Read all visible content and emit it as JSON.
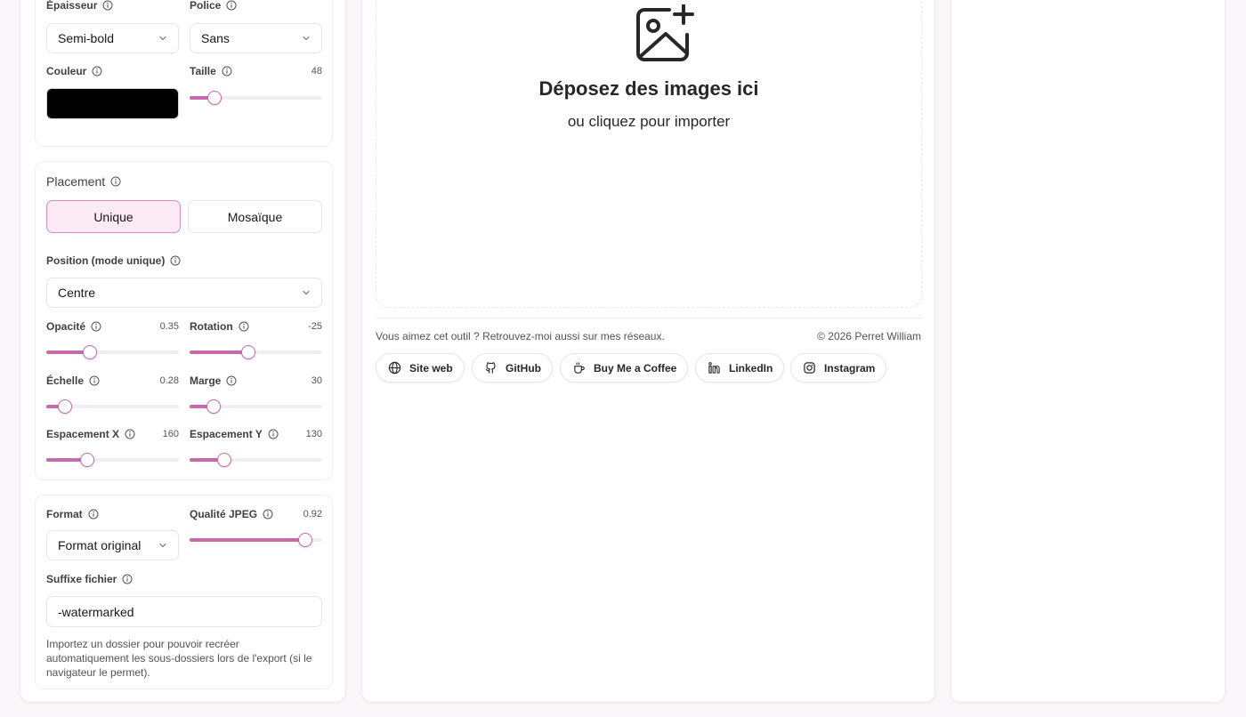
{
  "typography": {
    "weight": {
      "label": "Épaisseur",
      "value": "Semi-bold"
    },
    "font": {
      "label": "Police",
      "value": "Sans"
    },
    "color": {
      "label": "Couleur",
      "value": "#000000"
    },
    "size": {
      "label": "Taille",
      "value": 48,
      "fraction": 0.19
    }
  },
  "placement": {
    "title": "Placement",
    "modes": [
      "Unique",
      "Mosaïque"
    ],
    "active_mode": "Unique",
    "position": {
      "label": "Position (mode unique)",
      "value": "Centre"
    },
    "opacity": {
      "label": "Opacité",
      "value": "0.35",
      "fraction": 0.33
    },
    "rotation": {
      "label": "Rotation",
      "value": "-25",
      "fraction": 0.44
    },
    "scale": {
      "label": "Échelle",
      "value": "0.28",
      "fraction": 0.14
    },
    "margin": {
      "label": "Marge",
      "value": "30",
      "fraction": 0.18
    },
    "spacing_x": {
      "label": "Espacement X",
      "value": "160",
      "fraction": 0.31
    },
    "spacing_y": {
      "label": "Espacement Y",
      "value": "130",
      "fraction": 0.26
    }
  },
  "export": {
    "format": {
      "label": "Format",
      "value": "Format original"
    },
    "quality": {
      "label": "Qualité JPEG",
      "value": "0.92",
      "fraction": 0.87
    },
    "suffix": {
      "label": "Suffixe fichier",
      "value": "-watermarked"
    },
    "help": "Importez un dossier pour pouvoir recréer automatiquement les sous-dossiers lors de l'export (si le navigateur le permet)."
  },
  "dropzone": {
    "title": "Déposez des images ici",
    "subtitle": "ou cliquez pour importer",
    "icon": "image-plus-icon"
  },
  "footer": {
    "tagline": "Vous aimez cet outil ? Retrouvez-moi aussi sur mes réseaux.",
    "copyright": "© 2026 Perret William",
    "links": [
      {
        "label": "Site web",
        "icon": "globe-icon"
      },
      {
        "label": "GitHub",
        "icon": "github-icon"
      },
      {
        "label": "Buy Me a Coffee",
        "icon": "coffee-icon"
      },
      {
        "label": "LinkedIn",
        "icon": "linkedin-icon"
      },
      {
        "label": "Instagram",
        "icon": "instagram-icon"
      }
    ]
  },
  "colors": {
    "accent": "#c76aa9",
    "accent_light": "#fbeaf4",
    "page_bg": "#faf6fa"
  }
}
